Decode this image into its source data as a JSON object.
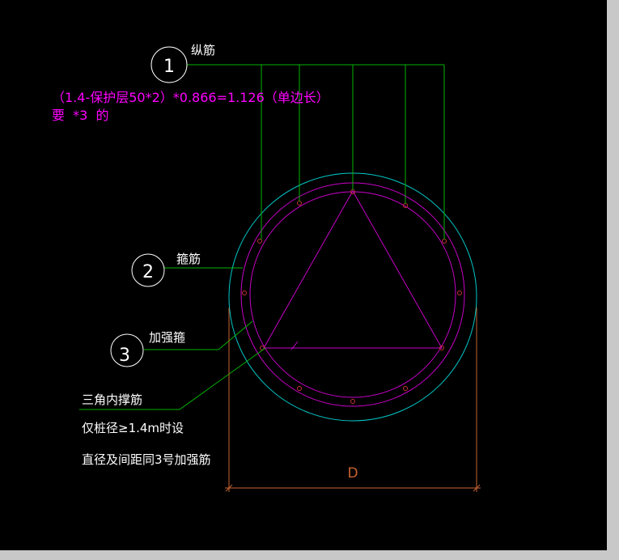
{
  "labels": {
    "longitudinal_num": "1",
    "longitudinal_name": "纵筋",
    "stirrup_num": "2",
    "stirrup_name": "箍筋",
    "stiffener_num": "3",
    "stiffener_name": "加强箍",
    "triangle_name": "三角内撑筋",
    "note_line1": "仅桩径≥1.4m时设",
    "note_line2": "直径及间距同3号加强筋",
    "dimension": "D"
  },
  "annotation": {
    "line1": "（1.4-保护层50*2）*0.866=1.126（单边长）",
    "line2": "要  *3  的"
  },
  "colors": {
    "background": "#000000",
    "frame": "#c8c8c8",
    "outer_circle": "#00c8c8",
    "rebar_cage": "#c800c8",
    "leaders": "#00b400",
    "text": "#ffffff",
    "annotation": "#ff00ff",
    "rebar_dots": "#c83232",
    "dimension": "#c86432"
  }
}
